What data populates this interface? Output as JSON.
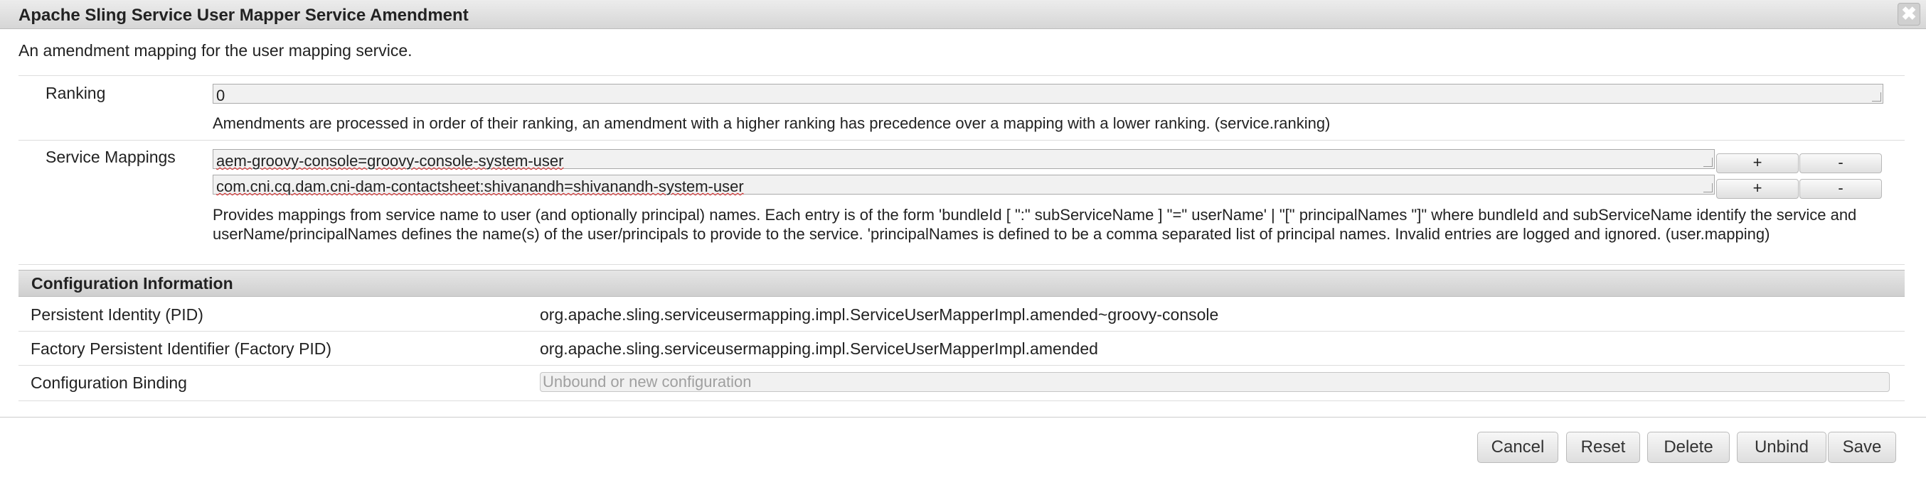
{
  "dialog": {
    "title": "Apache Sling Service User Mapper Service Amendment",
    "close_glyph": "✖",
    "description": "An amendment mapping for the user mapping service."
  },
  "ranking": {
    "label": "Ranking",
    "value": "0",
    "help": "Amendments are processed in order of their ranking, an amendment with a higher ranking has precedence over a mapping with a lower ranking. (service.ranking)"
  },
  "service_mappings": {
    "label": "Service Mappings",
    "entries": [
      "aem-groovy-console=groovy-console-system-user",
      "com.cni.cq.dam.cni-dam-contactsheet:shivanandh=shivanandh-system-user"
    ],
    "add_label": "+",
    "remove_label": "-",
    "help": "Provides mappings from service name to user (and optionally principal) names. Each entry is of the form 'bundleId [ \":\" subServiceName ] \"=\" userName' | \"[\" principalNames \"]\" where bundleId and subServiceName identify the service and userName/principalNames defines the name(s) of the user/principals to provide to the service. 'principalNames is defined to be a comma separated list of principal names. Invalid entries are logged and ignored. (user.mapping)"
  },
  "config_info": {
    "heading": "Configuration Information",
    "pid_label": "Persistent Identity (PID)",
    "pid_value": "org.apache.sling.serviceusermapping.impl.ServiceUserMapperImpl.amended~groovy-console",
    "factory_pid_label": "Factory Persistent Identifier (Factory PID)",
    "factory_pid_value": "org.apache.sling.serviceusermapping.impl.ServiceUserMapperImpl.amended",
    "binding_label": "Configuration Binding",
    "binding_value": "Unbound or new configuration"
  },
  "footer": {
    "cancel": "Cancel",
    "reset": "Reset",
    "delete": "Delete",
    "unbind": "Unbind",
    "save": "Save"
  }
}
